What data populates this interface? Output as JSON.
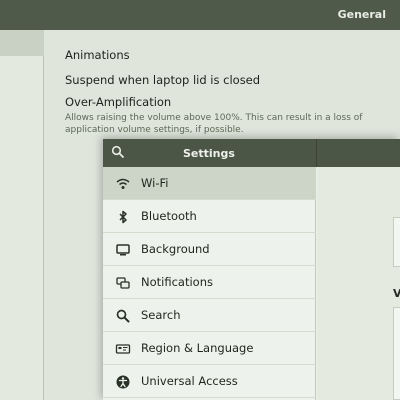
{
  "background_window": {
    "title": "General",
    "rows": {
      "animations": "Animations",
      "suspend": "Suspend when laptop lid is closed",
      "over_amp": "Over-Amplification",
      "over_amp_desc_line1": "Allows raising the volume above 100%. This can result in a loss of",
      "over_amp_desc_line2": "application volume settings, if possible."
    }
  },
  "settings": {
    "title": "Settings",
    "items": [
      {
        "label": "Wi-Fi",
        "icon": "wifi-icon",
        "selected": true
      },
      {
        "label": "Bluetooth",
        "icon": "bluetooth-icon",
        "selected": false
      },
      {
        "label": "Background",
        "icon": "background-icon",
        "selected": false
      },
      {
        "label": "Notifications",
        "icon": "notifications-icon",
        "selected": false
      },
      {
        "label": "Search",
        "icon": "search-icon",
        "selected": false
      },
      {
        "label": "Region & Language",
        "icon": "region-icon",
        "selected": false
      },
      {
        "label": "Universal Access",
        "icon": "universal-access-icon",
        "selected": false
      }
    ],
    "right_letter": "V"
  },
  "colors": {
    "header_bg": "#4f5a4a",
    "settings_header_bg": "#4b5646",
    "selected_bg": "#cdd5c8"
  }
}
